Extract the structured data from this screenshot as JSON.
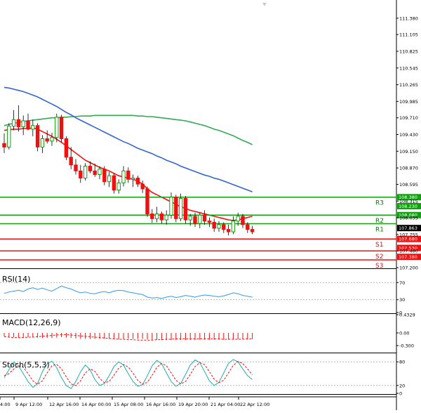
{
  "chart_data": {
    "type": "candlestick",
    "main": {
      "price_axis": [
        "111.380",
        "111.105",
        "110.825",
        "110.545",
        "110.265",
        "109.985",
        "109.710",
        "109.430",
        "109.150",
        "108.870",
        "108.595",
        "108.315",
        "108.035",
        "107.755",
        "107.480",
        "107.200"
      ],
      "ylim": [
        107.2,
        111.59
      ],
      "candles": [
        {
          "o": 109.28,
          "h": 109.45,
          "l": 109.12,
          "c": 109.22
        },
        {
          "o": 109.22,
          "h": 109.62,
          "l": 109.18,
          "c": 109.57
        },
        {
          "o": 109.57,
          "h": 109.84,
          "l": 109.5,
          "c": 109.68
        },
        {
          "o": 109.68,
          "h": 109.92,
          "l": 109.48,
          "c": 109.56
        },
        {
          "o": 109.56,
          "h": 109.75,
          "l": 109.42,
          "c": 109.66
        },
        {
          "o": 109.66,
          "h": 109.78,
          "l": 109.5,
          "c": 109.52
        },
        {
          "o": 109.52,
          "h": 109.68,
          "l": 109.4,
          "c": 109.58
        },
        {
          "o": 109.58,
          "h": 109.62,
          "l": 109.15,
          "c": 109.22
        },
        {
          "o": 109.22,
          "h": 109.42,
          "l": 109.12,
          "c": 109.36
        },
        {
          "o": 109.36,
          "h": 109.5,
          "l": 109.28,
          "c": 109.32
        },
        {
          "o": 109.32,
          "h": 109.46,
          "l": 109.24,
          "c": 109.38
        },
        {
          "o": 109.38,
          "h": 109.78,
          "l": 109.3,
          "c": 109.72
        },
        {
          "o": 109.72,
          "h": 109.76,
          "l": 109.3,
          "c": 109.36
        },
        {
          "o": 109.36,
          "h": 109.4,
          "l": 109.0,
          "c": 109.05
        },
        {
          "o": 109.05,
          "h": 109.22,
          "l": 108.85,
          "c": 108.92
        },
        {
          "o": 108.92,
          "h": 109.02,
          "l": 108.76,
          "c": 108.82
        },
        {
          "o": 108.82,
          "h": 108.92,
          "l": 108.62,
          "c": 108.7
        },
        {
          "o": 108.7,
          "h": 108.95,
          "l": 108.66,
          "c": 108.9
        },
        {
          "o": 108.9,
          "h": 108.98,
          "l": 108.78,
          "c": 108.82
        },
        {
          "o": 108.82,
          "h": 108.94,
          "l": 108.72,
          "c": 108.76
        },
        {
          "o": 108.76,
          "h": 108.9,
          "l": 108.68,
          "c": 108.85
        },
        {
          "o": 108.85,
          "h": 108.9,
          "l": 108.58,
          "c": 108.64
        },
        {
          "o": 108.64,
          "h": 108.8,
          "l": 108.55,
          "c": 108.74
        },
        {
          "o": 108.74,
          "h": 108.78,
          "l": 108.44,
          "c": 108.5
        },
        {
          "o": 108.5,
          "h": 108.68,
          "l": 108.44,
          "c": 108.62
        },
        {
          "o": 108.62,
          "h": 108.9,
          "l": 108.56,
          "c": 108.82
        },
        {
          "o": 108.82,
          "h": 108.88,
          "l": 108.62,
          "c": 108.68
        },
        {
          "o": 108.68,
          "h": 108.76,
          "l": 108.55,
          "c": 108.7
        },
        {
          "o": 108.7,
          "h": 108.74,
          "l": 108.55,
          "c": 108.6
        },
        {
          "o": 108.6,
          "h": 108.66,
          "l": 108.45,
          "c": 108.52
        },
        {
          "o": 108.52,
          "h": 108.56,
          "l": 108.05,
          "c": 108.1
        },
        {
          "o": 108.1,
          "h": 108.18,
          "l": 107.95,
          "c": 108.02
        },
        {
          "o": 108.02,
          "h": 108.22,
          "l": 107.96,
          "c": 108.1
        },
        {
          "o": 108.1,
          "h": 108.14,
          "l": 107.94,
          "c": 108.0
        },
        {
          "o": 108.0,
          "h": 108.16,
          "l": 107.92,
          "c": 108.08
        },
        {
          "o": 108.08,
          "h": 108.46,
          "l": 108.02,
          "c": 108.38
        },
        {
          "o": 108.38,
          "h": 108.42,
          "l": 107.96,
          "c": 108.02
        },
        {
          "o": 108.02,
          "h": 108.44,
          "l": 107.98,
          "c": 108.36
        },
        {
          "o": 108.36,
          "h": 108.4,
          "l": 107.94,
          "c": 108.0
        },
        {
          "o": 108.0,
          "h": 108.1,
          "l": 107.9,
          "c": 108.06
        },
        {
          "o": 108.06,
          "h": 108.12,
          "l": 107.88,
          "c": 107.94
        },
        {
          "o": 107.94,
          "h": 108.12,
          "l": 107.86,
          "c": 108.08
        },
        {
          "o": 108.08,
          "h": 108.16,
          "l": 107.92,
          "c": 107.98
        },
        {
          "o": 107.98,
          "h": 108.04,
          "l": 107.88,
          "c": 107.96
        },
        {
          "o": 107.96,
          "h": 108.02,
          "l": 107.8,
          "c": 107.86
        },
        {
          "o": 107.86,
          "h": 107.98,
          "l": 107.8,
          "c": 107.92
        },
        {
          "o": 107.92,
          "h": 107.96,
          "l": 107.78,
          "c": 107.84
        },
        {
          "o": 107.84,
          "h": 107.92,
          "l": 107.74,
          "c": 107.8
        },
        {
          "o": 107.8,
          "h": 108.06,
          "l": 107.76,
          "c": 107.98
        },
        {
          "o": 107.98,
          "h": 108.12,
          "l": 107.9,
          "c": 108.06
        },
        {
          "o": 108.06,
          "h": 108.1,
          "l": 107.86,
          "c": 107.92
        },
        {
          "o": 107.92,
          "h": 107.96,
          "l": 107.78,
          "c": 107.84
        },
        {
          "o": 107.84,
          "h": 107.9,
          "l": 107.76,
          "c": 107.8
        }
      ],
      "red_ma": [
        109.5,
        109.51,
        109.52,
        109.52,
        109.53,
        109.53,
        109.54,
        109.52,
        109.48,
        109.44,
        109.4,
        109.35,
        109.3,
        109.24,
        109.18,
        109.12,
        109.06,
        109.0,
        108.96,
        108.92,
        108.88,
        108.85,
        108.82,
        108.78,
        108.74,
        108.72,
        108.7,
        108.68,
        108.65,
        108.6,
        108.52,
        108.46,
        108.42,
        108.38,
        108.34,
        108.3,
        108.26,
        108.22,
        108.19,
        108.16,
        108.14,
        108.12,
        108.1,
        108.08,
        108.06,
        108.04,
        108.02,
        108.0,
        107.99,
        108.0,
        108.02,
        108.04,
        108.06
      ],
      "blue_ma": [
        110.22,
        110.21,
        110.19,
        110.17,
        110.15,
        110.12,
        110.09,
        110.06,
        110.02,
        109.98,
        109.94,
        109.9,
        109.85,
        109.8,
        109.76,
        109.71,
        109.67,
        109.63,
        109.59,
        109.55,
        109.51,
        109.47,
        109.43,
        109.39,
        109.35,
        109.31,
        109.28,
        109.24,
        109.2,
        109.17,
        109.14,
        109.11,
        109.07,
        109.04,
        109.0,
        108.97,
        108.94,
        108.9,
        108.87,
        108.84,
        108.81,
        108.78,
        108.75,
        108.73,
        108.7,
        108.68,
        108.65,
        108.62,
        108.59,
        108.56,
        108.53,
        108.5,
        108.47
      ],
      "green_ma": [
        109.58,
        109.6,
        109.62,
        109.63,
        109.65,
        109.66,
        109.67,
        109.68,
        109.69,
        109.7,
        109.71,
        109.71,
        109.72,
        109.72,
        109.73,
        109.73,
        109.74,
        109.74,
        109.74,
        109.75,
        109.75,
        109.75,
        109.75,
        109.75,
        109.75,
        109.75,
        109.75,
        109.75,
        109.74,
        109.74,
        109.73,
        109.73,
        109.72,
        109.71,
        109.7,
        109.69,
        109.68,
        109.67,
        109.66,
        109.64,
        109.62,
        109.6,
        109.58,
        109.55,
        109.52,
        109.5,
        109.47,
        109.44,
        109.41,
        109.37,
        109.33,
        109.3,
        109.26
      ],
      "levels": [
        {
          "label": "R3",
          "tag": "108.380",
          "value": 108.38,
          "color": "#10a010"
        },
        {
          "label": "",
          "tag": "108.230",
          "value": 108.23,
          "color": "#10a010"
        },
        {
          "label": "R2",
          "tag": "108.080",
          "value": 108.08,
          "color": "#10a010"
        },
        {
          "label": "R1",
          "tag": "",
          "value": 107.935,
          "color": "#10a010"
        },
        {
          "label": "S1",
          "tag": "107.680",
          "value": 107.68,
          "color": "#ee1111"
        },
        {
          "label": "",
          "tag": "107.530",
          "value": 107.53,
          "color": "#ee1111"
        },
        {
          "label": "S2",
          "tag": "",
          "value": 107.48,
          "color": "#ee1111"
        },
        {
          "label": "",
          "tag": "107.380",
          "value": 107.38,
          "color": "#ee1111"
        },
        {
          "label": "S3",
          "tag": "",
          "value": 107.33,
          "color": "#ee1111"
        }
      ],
      "current_price": {
        "tag": "107.863",
        "value": 107.863
      },
      "colors": {
        "bull": "#10a010",
        "bear": "#ee1111",
        "red_ma": "#ee1111",
        "blue_ma": "#3366cc",
        "green_ma": "#33aa55"
      }
    },
    "rsi": {
      "title": "RSI(14)",
      "axis": [
        "70",
        "30",
        "0"
      ],
      "ylim": [
        0,
        100
      ],
      "values": [
        45,
        48,
        50,
        52,
        49,
        55,
        58,
        54,
        57,
        53,
        50,
        56,
        62,
        58,
        55,
        50,
        46,
        48,
        45,
        44,
        47,
        49,
        46,
        50,
        52,
        51,
        48,
        46,
        44,
        42,
        36,
        34,
        35,
        33,
        36,
        38,
        35,
        37,
        40,
        38,
        36,
        39,
        41,
        40,
        38,
        37,
        39,
        42,
        46,
        44,
        40,
        38,
        36
      ],
      "color": "#3399ee"
    },
    "macd": {
      "title": "MACD(12,26,9)",
      "axis": [
        "0.4329",
        "0.00",
        "-0.300"
      ],
      "ylim": [
        -0.45,
        0.45
      ],
      "histogram": [
        -0.08,
        -0.09,
        -0.1,
        -0.1,
        -0.11,
        -0.1,
        -0.1,
        -0.11,
        -0.12,
        -0.12,
        -0.12,
        -0.11,
        -0.1,
        -0.11,
        -0.12,
        -0.13,
        -0.14,
        -0.14,
        -0.14,
        -0.14,
        -0.14,
        -0.14,
        -0.14,
        -0.14,
        -0.15,
        -0.14,
        -0.14,
        -0.14,
        -0.14,
        -0.14,
        -0.15,
        -0.16,
        -0.16,
        -0.17,
        -0.17,
        -0.17,
        -0.17,
        -0.17,
        -0.17,
        -0.17,
        -0.17,
        -0.16,
        -0.16,
        -0.16,
        -0.16,
        -0.16,
        -0.16,
        -0.16,
        -0.16,
        -0.15,
        -0.15,
        -0.15,
        -0.15
      ],
      "signal": [
        -0.09,
        -0.1,
        -0.11,
        -0.11,
        -0.11,
        -0.1,
        -0.1,
        -0.09,
        -0.08,
        -0.07,
        -0.06,
        -0.05,
        -0.04,
        -0.04,
        -0.05,
        -0.06,
        -0.07,
        -0.08,
        -0.09,
        -0.1,
        -0.11,
        -0.12,
        -0.13,
        -0.14,
        -0.15,
        -0.15,
        -0.16,
        -0.16,
        -0.17,
        -0.17,
        -0.17,
        -0.17,
        -0.16,
        -0.16,
        -0.15,
        -0.15,
        -0.14,
        -0.14,
        -0.14,
        -0.14,
        -0.14,
        -0.14,
        -0.14,
        -0.14,
        -0.14,
        -0.14,
        -0.15,
        -0.15,
        -0.15,
        -0.15,
        -0.15,
        -0.14,
        -0.14
      ],
      "hist_color": "#ee1111",
      "signal_color": "#ee1111"
    },
    "stoch": {
      "title": "Stoch(5,5,3)",
      "axis": [
        "80",
        "20",
        "0"
      ],
      "ylim": [
        0,
        100
      ],
      "main": [
        40,
        60,
        80,
        70,
        50,
        30,
        15,
        25,
        55,
        75,
        82,
        65,
        40,
        20,
        12,
        30,
        55,
        72,
        60,
        35,
        20,
        25,
        45,
        68,
        80,
        72,
        50,
        30,
        18,
        22,
        45,
        70,
        84,
        75,
        52,
        30,
        18,
        25,
        48,
        72,
        85,
        78,
        55,
        32,
        20,
        28,
        52,
        76,
        86,
        80,
        62,
        45,
        35
      ],
      "signal": [
        45,
        50,
        62,
        70,
        66,
        50,
        32,
        23,
        32,
        52,
        70,
        74,
        62,
        42,
        24,
        20,
        32,
        52,
        62,
        56,
        38,
        27,
        30,
        46,
        64,
        73,
        67,
        51,
        33,
        23,
        28,
        46,
        66,
        76,
        70,
        52,
        33,
        24,
        30,
        48,
        68,
        78,
        73,
        55,
        36,
        27,
        33,
        52,
        71,
        81,
        76,
        62,
        47
      ],
      "main_color": "#22aaaa",
      "signal_color": "#ee1111"
    },
    "time_axis": [
      "4:00",
      "9 Apr 12:00",
      "12 Apr 16:00",
      "14 Apr 00:00",
      "15 Apr 08:00",
      "16 Apr 16:00",
      "19 Apr 20:00",
      "21 Apr 04:00",
      "22 Apr 12:00"
    ]
  }
}
